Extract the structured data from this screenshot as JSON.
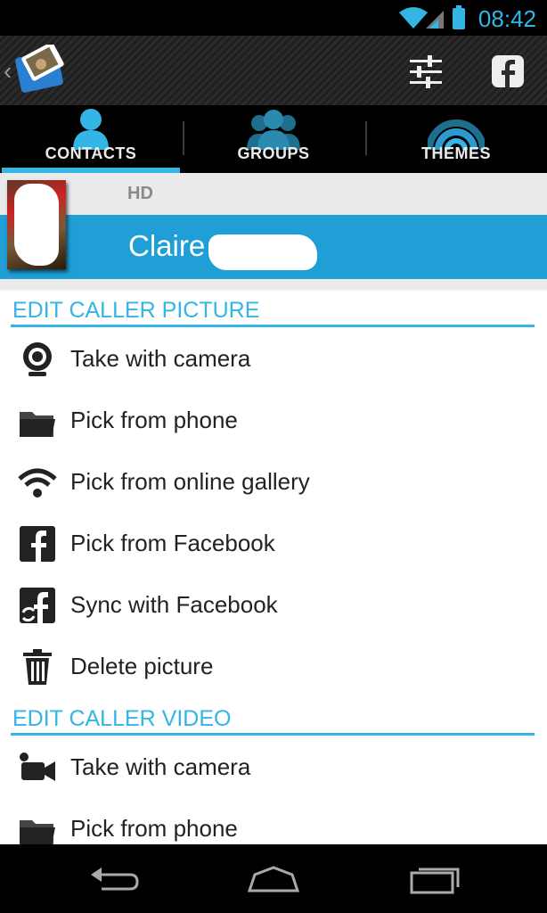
{
  "status_bar": {
    "time": "08:42"
  },
  "action_bar": {
    "icons": [
      "app-logo",
      "settings-sliders-icon",
      "facebook-icon"
    ]
  },
  "tabs": [
    {
      "label": "CONTACTS",
      "icon": "contact-person-icon",
      "selected": true
    },
    {
      "label": "GROUPS",
      "icon": "group-people-icon",
      "selected": false
    },
    {
      "label": "THEMES",
      "icon": "theme-arcs-icon",
      "selected": false
    }
  ],
  "contact": {
    "badge": "HD",
    "name": "Claire"
  },
  "sections": {
    "picture": {
      "title": "EDIT CALLER PICTURE",
      "items": [
        {
          "label": "Take with camera",
          "icon": "webcam-icon"
        },
        {
          "label": "Pick from phone",
          "icon": "folder-icon"
        },
        {
          "label": "Pick from online gallery",
          "icon": "wifi-icon"
        },
        {
          "label": "Pick from Facebook",
          "icon": "facebook-icon"
        },
        {
          "label": "Sync with Facebook",
          "icon": "facebook-sync-icon"
        },
        {
          "label": "Delete picture",
          "icon": "trash-icon"
        }
      ]
    },
    "video": {
      "title": "EDIT CALLER VIDEO",
      "items": [
        {
          "label": "Take with camera",
          "icon": "video-camera-icon"
        },
        {
          "label": "Pick from phone",
          "icon": "folder-icon"
        }
      ]
    }
  },
  "colors": {
    "accent": "#33b5e5",
    "name_band": "#1f9fd6"
  }
}
